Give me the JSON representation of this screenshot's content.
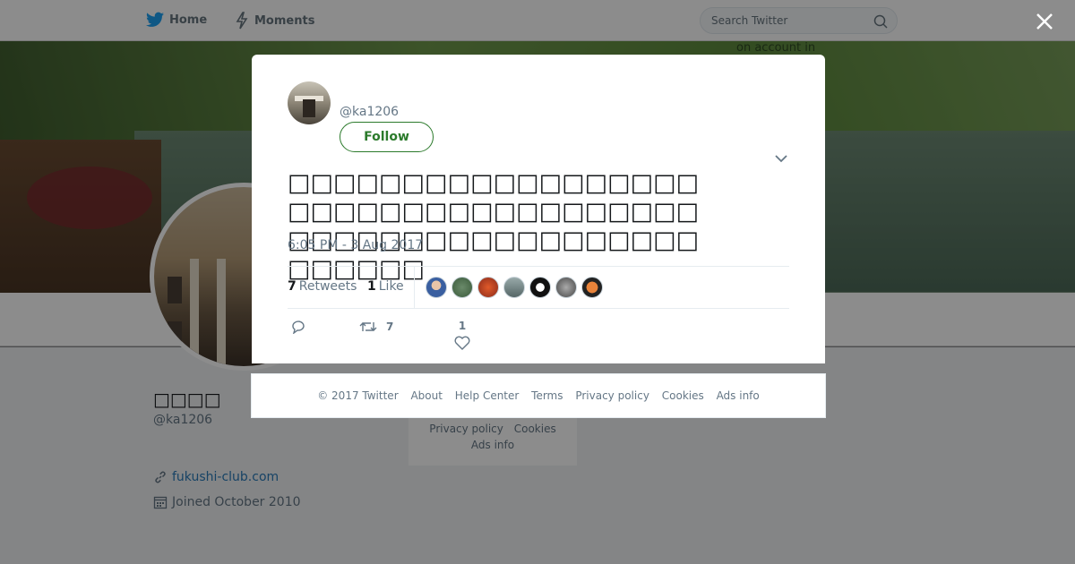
{
  "nav": {
    "home_label": "Home",
    "moments_label": "Moments",
    "search_placeholder": "Search Twitter",
    "accent": "#1da1f2"
  },
  "banner": {
    "faint_text": "on account in"
  },
  "profile": {
    "name": "□□□□",
    "handle": "@ka1206",
    "website": "fukushi-club.com",
    "joined": "Joined October 2010"
  },
  "bg_footer": {
    "privacy": "Privacy policy",
    "cookies": "Cookies",
    "ads": "Ads info"
  },
  "tweet": {
    "handle": "@ka1206",
    "follow_label": "Follow",
    "text": "□□□□□□□□□□□□□□□□□□□□□□□□□□□□□□□□□□□□□□□□□□□□□□□□□□□□□□□□□□□□",
    "timestamp": "6:05 PM - 3 Aug 2017",
    "retweets_count": "7",
    "retweets_label": "Retweets",
    "likes_count": "1",
    "likes_label": "Like",
    "reply_count": "",
    "retweet_action_count": "7",
    "like_action_count": "1",
    "accent": "#2b7a2b"
  },
  "footer": {
    "copyright": "© 2017 Twitter",
    "about": "About",
    "help": "Help Center",
    "terms": "Terms",
    "privacy": "Privacy policy",
    "cookies": "Cookies",
    "ads": "Ads info"
  }
}
